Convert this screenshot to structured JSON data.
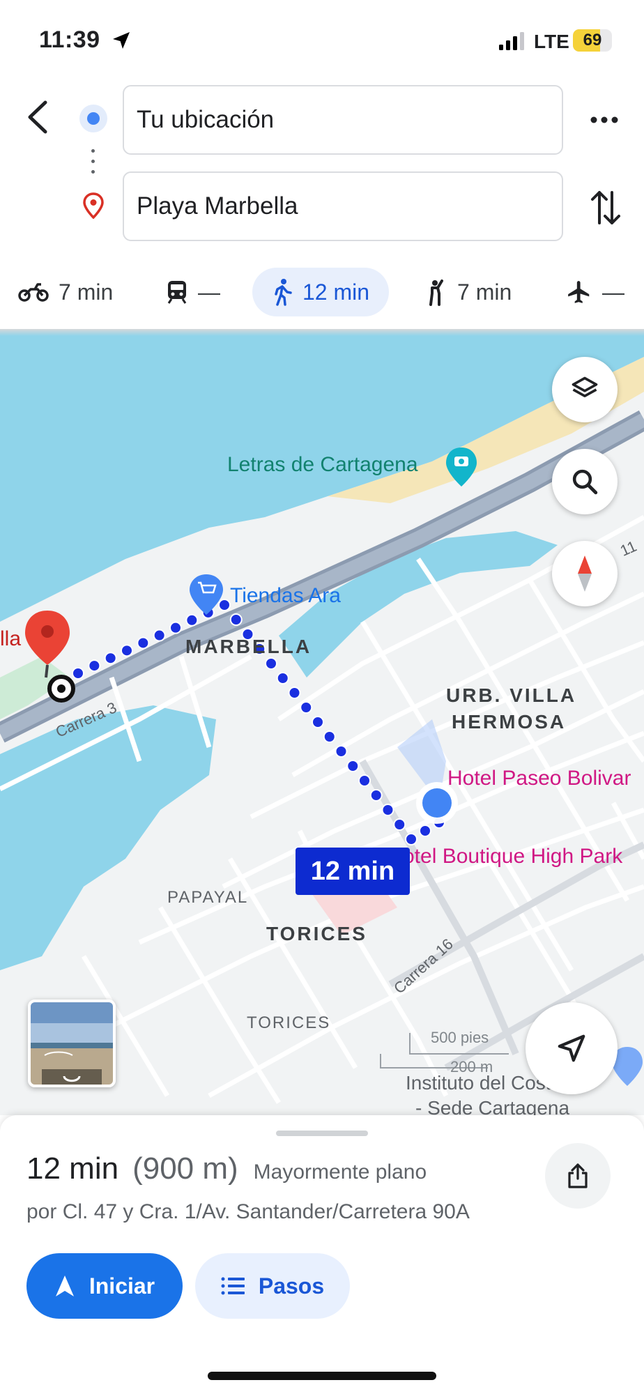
{
  "status_bar": {
    "time": "11:39",
    "network": "LTE",
    "battery": "69",
    "battery_level": 0.69
  },
  "header": {
    "origin_value": "Tu ubicación",
    "destination_value": "Playa Marbella",
    "back_icon": "chevron-left-icon",
    "more_icon": "more-horizontal-icon",
    "swap_icon": "swap-vertical-icon"
  },
  "travel_modes": [
    {
      "icon": "motorcycle-icon",
      "label": "7 min",
      "active": false
    },
    {
      "icon": "transit-icon",
      "label": "—",
      "active": false
    },
    {
      "icon": "walk-icon",
      "label": "12 min",
      "active": true
    },
    {
      "icon": "rideshare-icon",
      "label": "7 min",
      "active": false
    },
    {
      "icon": "flight-icon",
      "label": "—",
      "active": false
    }
  ],
  "map": {
    "labels": {
      "letras": "Letras de Cartagena",
      "tiendas": "Tiendas Ara",
      "marbella": "MARBELLA",
      "villa": "URB. VILLA",
      "hermosa": "HERMOSA",
      "hotel_paseo": "Hotel Paseo Bolivar",
      "hotel_boutique": "otel Boutique High Park",
      "papayal": "PAPAYAL",
      "torices_big": "TORICES",
      "torices_small": "TORICES",
      "carrera3": "Carrera 3",
      "carrera16": "Carrera 16",
      "instituto1": "Instituto del Costel",
      "instituto2": "- Sede Cartagena",
      "scale_feet": "500 pies",
      "scale_m": "200 m",
      "dest_partial": "lla",
      "road_11": "11"
    },
    "route_time": "12 min",
    "route_color": "#1a2fe0",
    "water_color": "#8fd4ea"
  },
  "sheet": {
    "time": "12 min",
    "distance": "(900 m)",
    "terrain": "Mayormente plano",
    "via": "por Cl. 47 y Cra. 1/Av. Santander/Carretera 90A",
    "start_label": "Iniciar",
    "steps_label": "Pasos"
  }
}
